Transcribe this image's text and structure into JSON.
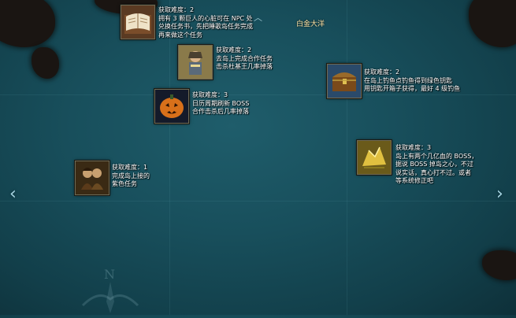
{
  "region_name": "白金大洋",
  "nav": {
    "left_arrow": "‹",
    "right_arrow": "›"
  },
  "entries": [
    {
      "id": "book",
      "icon": "book-icon",
      "lines": [
        "获取难度：2",
        "拥有 3 颗巨人的心脏可在 NPC 处",
        "兑换任务书，先把睡歌岛任务完成",
        "再来做这个任务"
      ]
    },
    {
      "id": "soldier",
      "icon": "soldier-figure-icon",
      "lines": [
        "获取难度：2",
        "去岛上完成合作任务",
        "击杀杜基王几率掉落"
      ]
    },
    {
      "id": "chest",
      "icon": "treasure-chest-icon",
      "lines": [
        "获取难度：2",
        "在岛上钓鱼点钓鱼得到绿色钥匙",
        "用钥匙开箱子获得，最好 4 级钓鱼"
      ]
    },
    {
      "id": "pumpkin",
      "icon": "pumpkin-icon",
      "lines": [
        "获取难度：3",
        "日历周期刷新 BOSS",
        "合作击杀后几率掉落"
      ]
    },
    {
      "id": "gold",
      "icon": "gold-fragment-icon",
      "lines": [
        "获取难度：3",
        "岛上有两个几亿血的 BOSS，",
        "据说 BOSS 掉岛之心，不过",
        "说实话，真心打不过。或者",
        "等系统修正吧"
      ]
    },
    {
      "id": "couple",
      "icon": "couple-portrait-icon",
      "lines": [
        "获取难度：1",
        "完成岛上接的",
        "紫色任务"
      ]
    }
  ]
}
